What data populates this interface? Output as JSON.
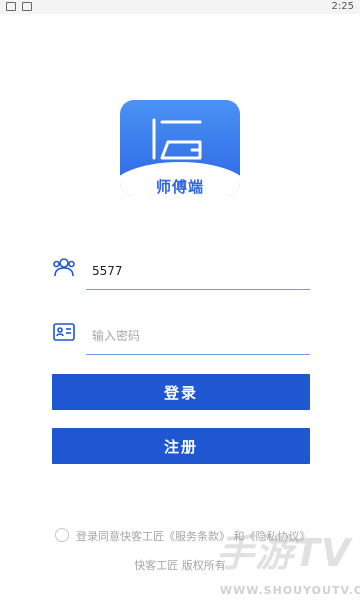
{
  "status_bar": {
    "time": "2:25"
  },
  "logo": {
    "text": "师傅端"
  },
  "username": {
    "value": "5577"
  },
  "password": {
    "placeholder": "输入密码"
  },
  "buttons": {
    "login": "登录",
    "register": "注册"
  },
  "agreement": {
    "prefix": "登录同意快客工匠",
    "terms": "《服务条款》",
    "and": "和",
    "privacy": "《隐私协议》"
  },
  "copyright": "快客工匠 版权所有",
  "watermark": {
    "main": "手游TV",
    "url": "WWW.SHOUYOUTV.COM"
  },
  "colors": {
    "primary": "#1e57cf",
    "accent": "#6f9ef0",
    "logo_blue": "#3a7bec"
  }
}
